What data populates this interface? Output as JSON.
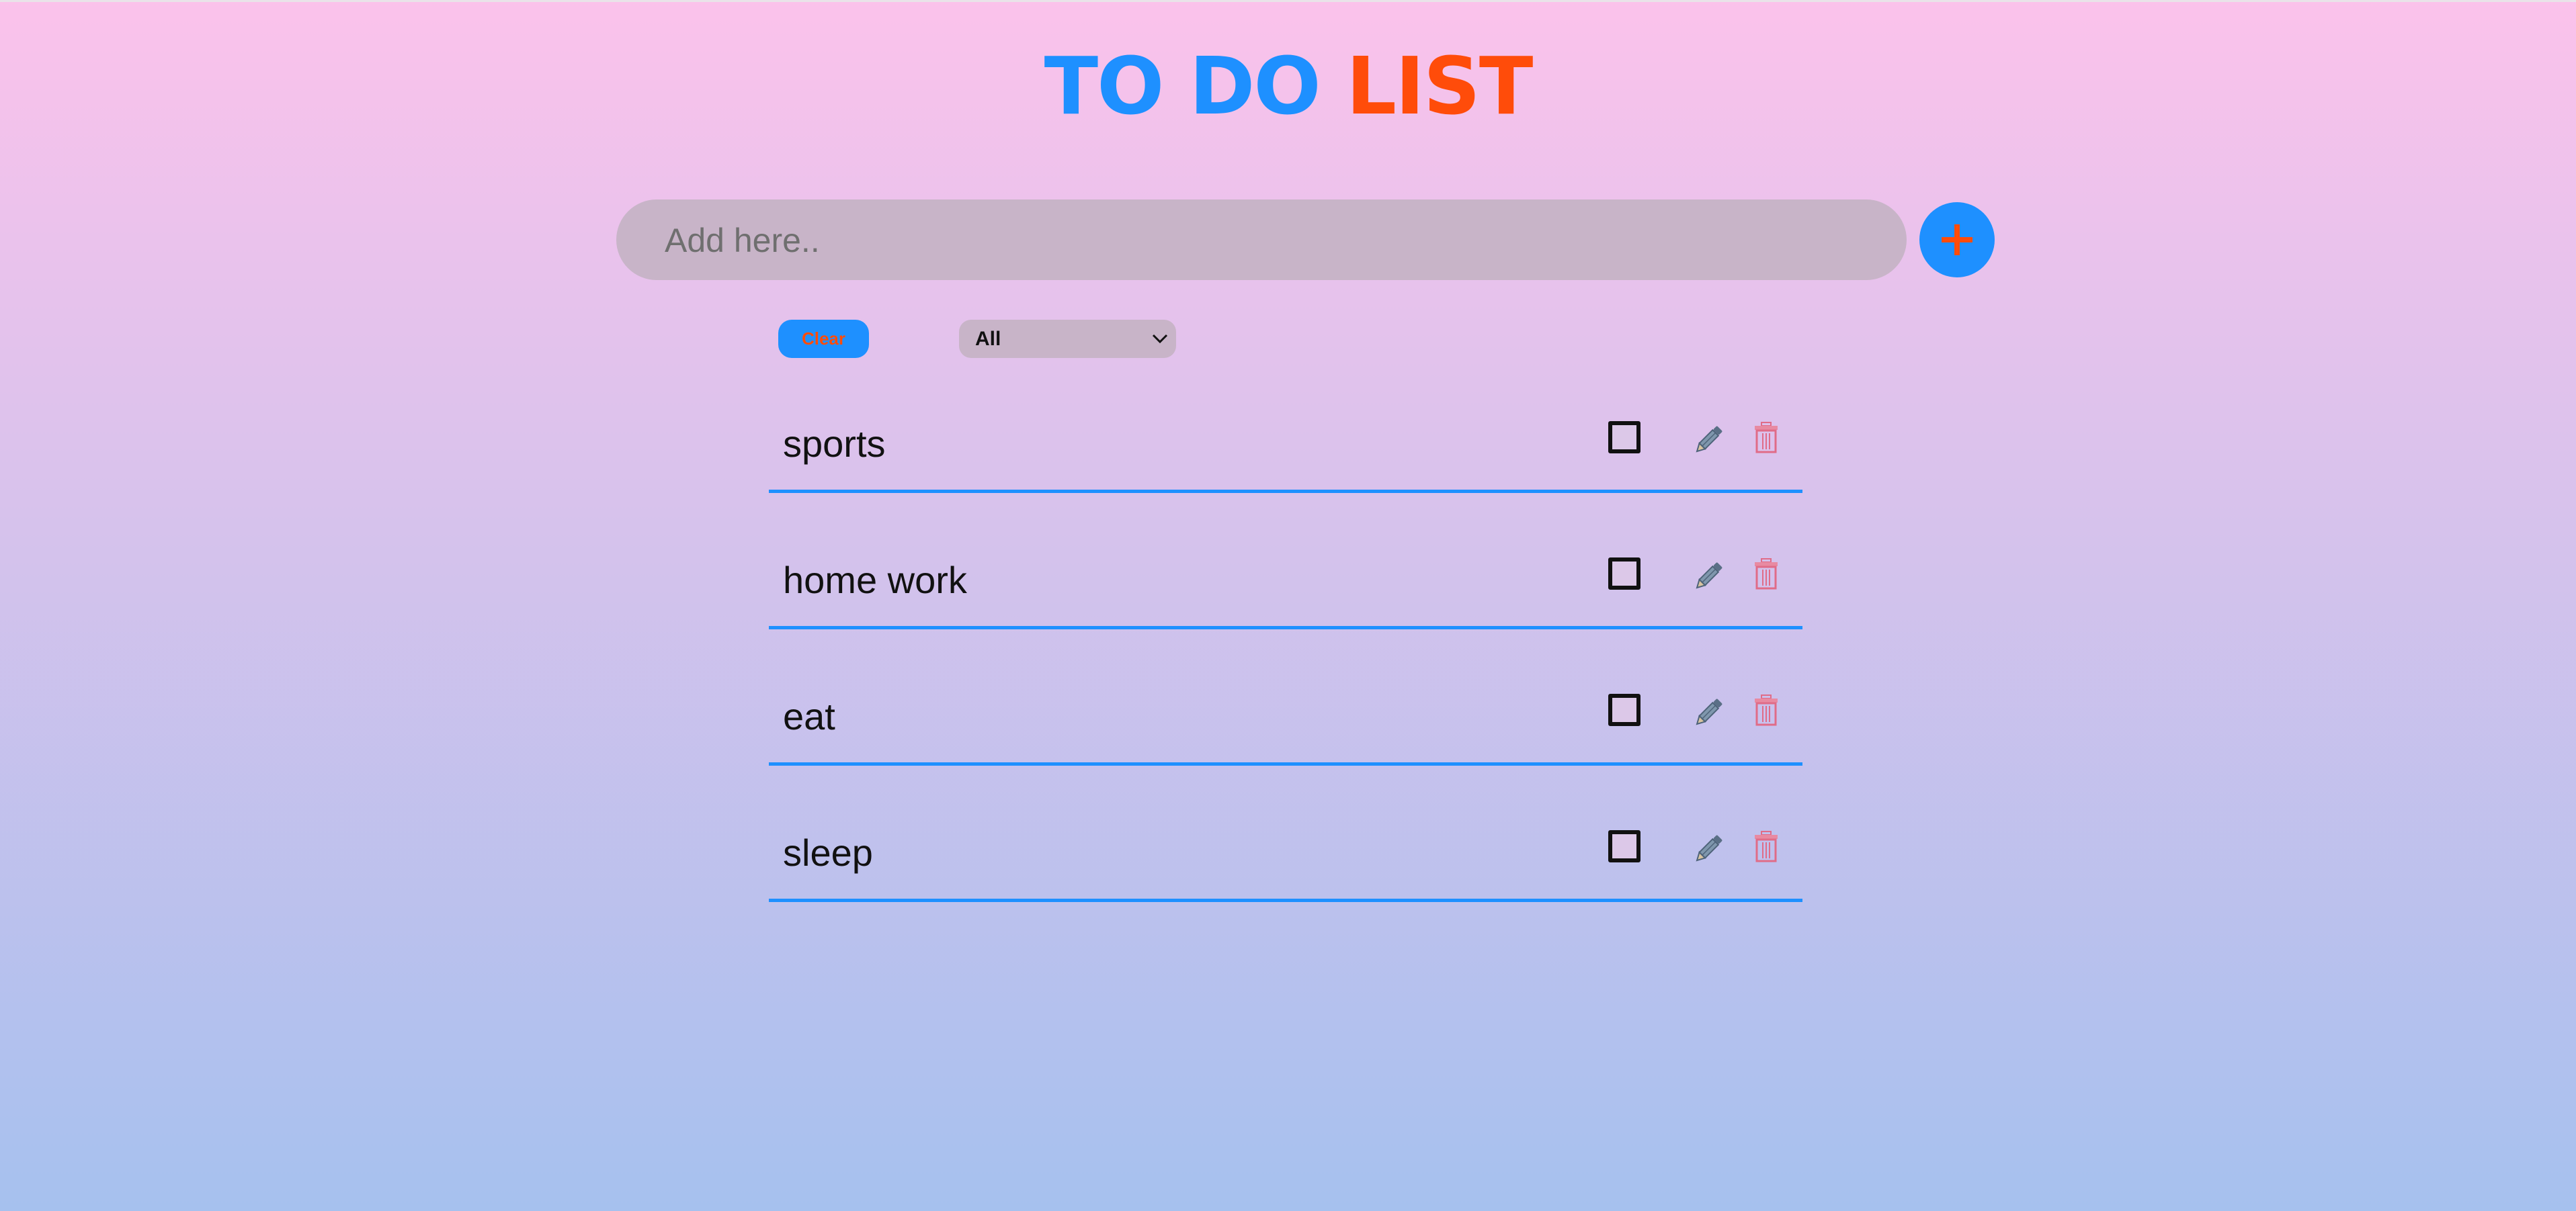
{
  "header": {
    "title_part1": "TO DO",
    "title_part2": "LIST"
  },
  "input": {
    "placeholder": "Add here..",
    "value": ""
  },
  "add_button": {
    "icon": "plus-icon"
  },
  "controls": {
    "clear_label": "Clear",
    "filter_selected": "All"
  },
  "todos": [
    {
      "label": "sports",
      "done": false
    },
    {
      "label": "home work",
      "done": false
    },
    {
      "label": "eat",
      "done": false
    },
    {
      "label": "sleep",
      "done": false
    }
  ],
  "colors": {
    "accent_blue": "#1e90ff",
    "accent_orange": "#ff4c0a",
    "input_bg": "#c8b4c8",
    "gradient_top": "#fbc2eb",
    "gradient_bottom": "#a6c1ee"
  }
}
